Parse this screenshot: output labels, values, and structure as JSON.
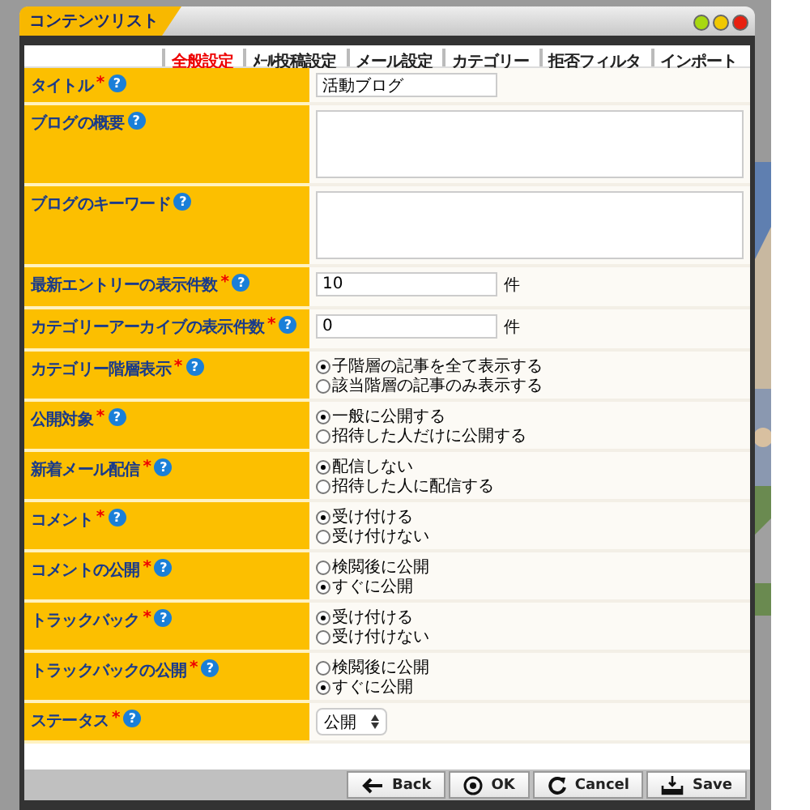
{
  "window": {
    "title": "コンテンツリスト",
    "controls": [
      {
        "color": "#a8d810"
      },
      {
        "color": "#f0c800"
      },
      {
        "color": "#e82010"
      }
    ]
  },
  "tabs": [
    {
      "label": "全般設定",
      "selected": true
    },
    {
      "label": "ﾒｰﾙ投稿設定",
      "selected": false
    },
    {
      "label": "メール設定",
      "selected": false
    },
    {
      "label": "カテゴリー",
      "selected": false
    },
    {
      "label": "拒否フィルタ",
      "selected": false
    },
    {
      "label": "インポート",
      "selected": false
    }
  ],
  "fields": [
    {
      "kind": "text",
      "label": "タイトル",
      "required": true,
      "value": "活動ブログ"
    },
    {
      "kind": "textarea",
      "label": "ブログの概要",
      "required": false
    },
    {
      "kind": "textarea",
      "label": "ブログのキーワード",
      "required": false
    },
    {
      "kind": "number",
      "label": "最新エントリーの表示件数",
      "required": true,
      "value": "10",
      "unit": "件"
    },
    {
      "kind": "number",
      "label": "カテゴリーアーカイブの表示件数",
      "required": true,
      "value": "0",
      "unit": "件"
    },
    {
      "kind": "radio",
      "label": "カテゴリー階層表示",
      "required": true,
      "options": [
        {
          "label": "子階層の記事を全て表示する",
          "selected": true
        },
        {
          "label": "該当階層の記事のみ表示する",
          "selected": false
        }
      ]
    },
    {
      "kind": "radio",
      "label": "公開対象",
      "required": true,
      "options": [
        {
          "label": "一般に公開する",
          "selected": true
        },
        {
          "label": "招待した人だけに公開する",
          "selected": false
        }
      ]
    },
    {
      "kind": "radio",
      "label": "新着メール配信",
      "required": true,
      "options": [
        {
          "label": "配信しない",
          "selected": true
        },
        {
          "label": "招待した人に配信する",
          "selected": false
        }
      ]
    },
    {
      "kind": "radio",
      "label": "コメント",
      "required": true,
      "options": [
        {
          "label": "受け付ける",
          "selected": true
        },
        {
          "label": "受け付けない",
          "selected": false
        }
      ]
    },
    {
      "kind": "radio",
      "label": "コメントの公開",
      "required": true,
      "options": [
        {
          "label": "検閲後に公開",
          "selected": false
        },
        {
          "label": "すぐに公開",
          "selected": true
        }
      ]
    },
    {
      "kind": "radio",
      "label": "トラックバック",
      "required": true,
      "options": [
        {
          "label": "受け付ける",
          "selected": true
        },
        {
          "label": "受け付けない",
          "selected": false
        }
      ]
    },
    {
      "kind": "radio",
      "label": "トラックバックの公開",
      "required": true,
      "options": [
        {
          "label": "検閲後に公開",
          "selected": false
        },
        {
          "label": "すぐに公開",
          "selected": true
        }
      ]
    },
    {
      "kind": "select",
      "label": "ステータス",
      "required": true,
      "value": "公開"
    }
  ],
  "required_mark": "*",
  "help_mark": "?",
  "buttons": [
    {
      "kind": "back",
      "label": "Back"
    },
    {
      "kind": "ok",
      "label": "OK"
    },
    {
      "kind": "cancel",
      "label": "Cancel"
    },
    {
      "kind": "save",
      "label": "Save"
    }
  ]
}
